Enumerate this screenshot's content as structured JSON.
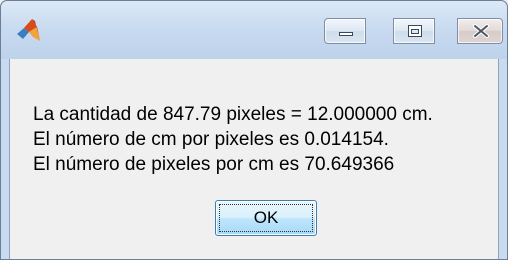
{
  "window": {
    "title": "",
    "icon": "matlab-logo-icon",
    "controls": {
      "minimize_icon": "minimize-icon",
      "maximize_icon": "maximize-icon",
      "close_icon": "close-icon"
    }
  },
  "dialog": {
    "lines": [
      "La cantidad de 847.79 pixeles = 12.000000 cm.",
      "El número de cm por pixeles es 0.014154.",
      "El número de pixeles por cm es 70.649366"
    ],
    "ok_label": "OK"
  },
  "colors": {
    "titlebar": "#c8daef",
    "client_bg": "#f0f0f0",
    "ok_border": "#3c7fb1"
  }
}
